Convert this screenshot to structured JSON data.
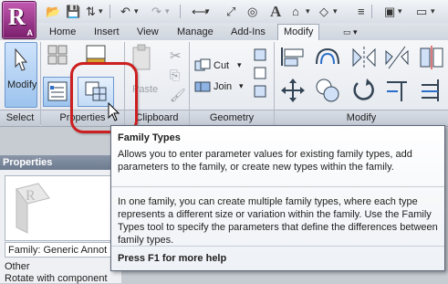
{
  "app": {
    "logo_letter": "R",
    "logo_sub": "A"
  },
  "tabs": [
    "Home",
    "Insert",
    "View",
    "Manage",
    "Add-Ins",
    "Modify",
    "▭ ▾"
  ],
  "ribbon": {
    "select": {
      "button": "Modify",
      "panel": "Select"
    },
    "properties": {
      "panel": "Properties"
    },
    "clipboard": {
      "paste": "Paste",
      "panel": "Clipboard"
    },
    "geometry": {
      "cut": "Cut",
      "join": "Join",
      "panel": "Geometry"
    },
    "modify": {
      "panel": "Modify"
    }
  },
  "tooltip": {
    "title": "Family Types",
    "description": "Allows you to enter parameter values for existing family types, add parameters to the family, or create new types within the family.",
    "long_description": "In one family, you can create multiple family types, where each type represents a different size or variation within the family. Use the Family Types tool to specify the parameters that define the differences between family types.",
    "help": "Press F1 for more help"
  },
  "properties_palette": {
    "title": "Properties",
    "family_label": "Family: Generic Annot",
    "group": "Other",
    "row": "Rotate with component"
  }
}
